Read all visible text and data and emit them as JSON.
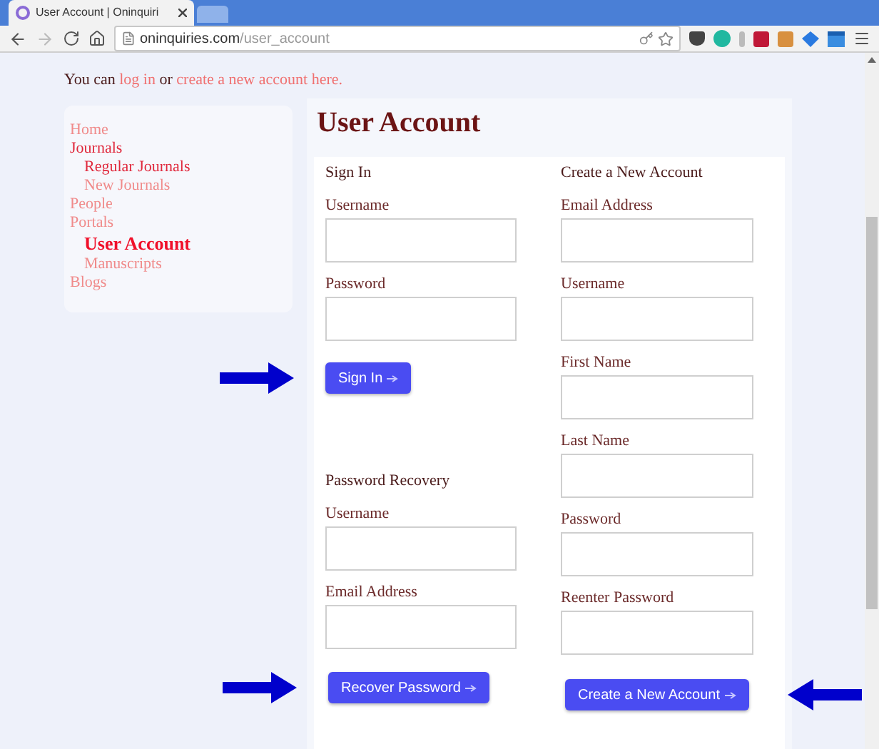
{
  "browser": {
    "tab_title": "User Account | Oninquiri",
    "url_domain": "oninquiries.com",
    "url_path": "/user_account"
  },
  "intro": {
    "before": "You can",
    "link_login": "log in",
    "middle": "or",
    "link_create": "create a new account here."
  },
  "sidebar": {
    "items": [
      {
        "label": "Home",
        "selected": false,
        "visited": false
      },
      {
        "label": "Journals",
        "selected": false,
        "visited": true,
        "children": [
          {
            "label": "Regular Journals",
            "selected": false,
            "visited": true
          },
          {
            "label": "New Journals",
            "selected": false,
            "visited": false
          }
        ]
      },
      {
        "label": "People",
        "selected": false,
        "visited": false
      },
      {
        "label": "Portals",
        "selected": false,
        "visited": false,
        "children": [
          {
            "label": "User Account",
            "selected": true
          },
          {
            "label": "Manuscripts",
            "selected": false,
            "visited": false
          }
        ]
      },
      {
        "label": "Blogs",
        "selected": false,
        "visited": false
      }
    ]
  },
  "page_title": "User Account",
  "sign_in": {
    "heading": "Sign In",
    "fields": [
      {
        "label": "Username"
      },
      {
        "label": "Password"
      }
    ],
    "button": {
      "label": "Sign In",
      "arrow_before": true
    }
  },
  "password_recovery": {
    "heading": "Password Recovery",
    "fields": [
      {
        "label": "Username"
      },
      {
        "label": "Email Address"
      }
    ],
    "button": {
      "label": "Recover Password",
      "arrow_before": true
    }
  },
  "create_account": {
    "heading": "Create a New Account",
    "fields": [
      {
        "label": "Email Address"
      },
      {
        "label": "Username"
      },
      {
        "label": "First Name"
      },
      {
        "label": "Last Name"
      },
      {
        "label": "Password"
      },
      {
        "label": "Reenter Password"
      }
    ],
    "button": {
      "label": "Create a New Account",
      "arrow_after": true
    }
  }
}
